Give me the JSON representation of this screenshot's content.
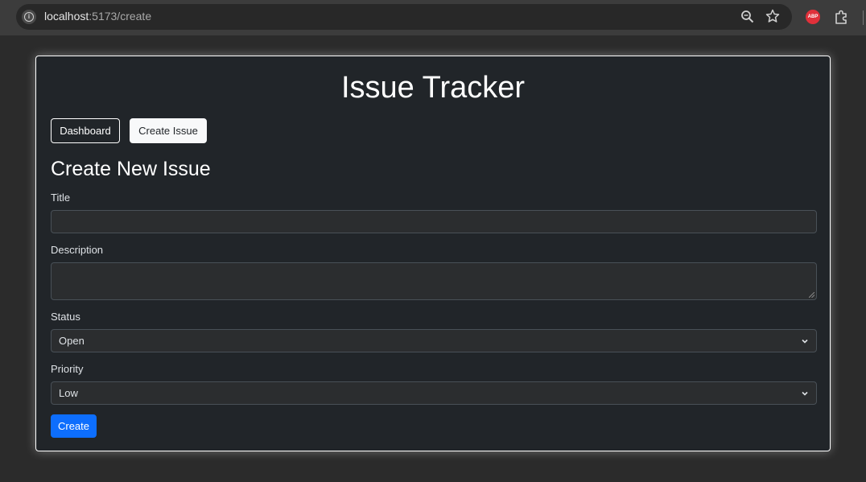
{
  "browser": {
    "url_host": "localhost",
    "url_path": ":5173/create",
    "icons": [
      "info-icon",
      "zoom-icon",
      "bookmark-star-icon",
      "adblock-plus-icon",
      "extensions-icon"
    ],
    "adblock_label": "ABP"
  },
  "app": {
    "title": "Issue Tracker",
    "nav": {
      "dashboard_label": "Dashboard",
      "create_issue_label": "Create Issue"
    }
  },
  "form": {
    "heading": "Create New Issue",
    "title_label": "Title",
    "title_value": "",
    "description_label": "Description",
    "description_value": "",
    "status_label": "Status",
    "status_value": "Open",
    "priority_label": "Priority",
    "priority_value": "Low",
    "submit_label": "Create"
  },
  "colors": {
    "page_bg": "#2b2b2b",
    "card_bg": "#212529",
    "primary": "#0d6efd",
    "light_button": "#f8f9fa"
  }
}
